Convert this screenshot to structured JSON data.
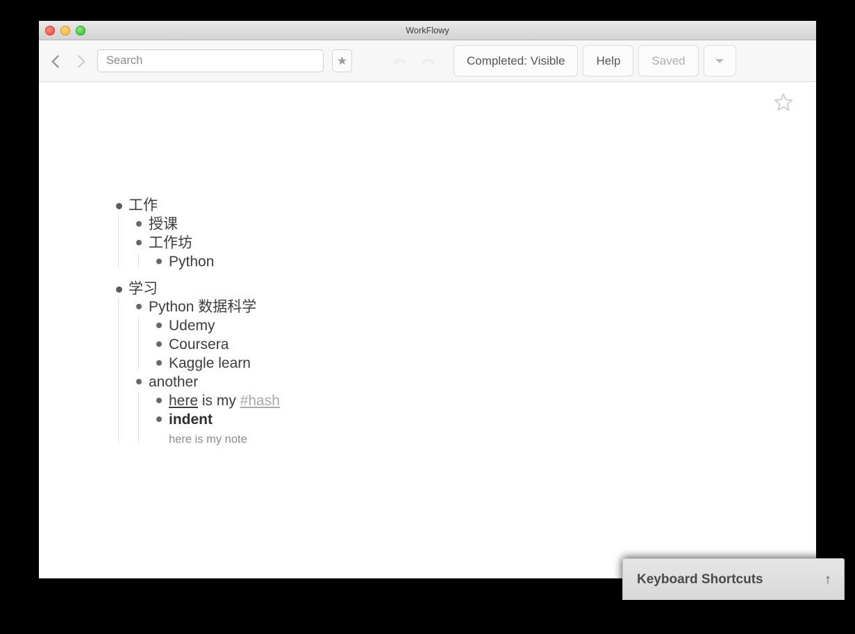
{
  "window": {
    "title": "WorkFlowy",
    "traffic_lights": [
      "close-button",
      "minimize-button",
      "maximize-button"
    ]
  },
  "toolbar": {
    "back_label": "‹",
    "forward_label": "›",
    "search": {
      "value": "",
      "placeholder": "Search"
    },
    "starred_button": "star-icon",
    "undo_label": "undo",
    "redo_label": "redo",
    "completed_label": "Completed: Visible",
    "help_label": "Help",
    "saved_label": "Saved",
    "menu_label": "▾"
  },
  "content": {
    "page_star": "star-outline-icon",
    "outline": [
      {
        "text": "工作",
        "level": 0,
        "children": [
          {
            "text": "授课",
            "level": 1,
            "children": []
          },
          {
            "text": "工作坊",
            "level": 1,
            "children": [
              {
                "text": "Python",
                "level": 2,
                "children": []
              }
            ]
          }
        ]
      },
      {
        "text": "学习",
        "level": 0,
        "children": [
          {
            "text": "Python 数据科学",
            "level": 1,
            "children": [
              {
                "text": "Udemy",
                "level": 2,
                "children": []
              },
              {
                "text": "Coursera",
                "level": 2,
                "children": []
              },
              {
                "text": "Kaggle learn",
                "level": 2,
                "children": []
              }
            ]
          },
          {
            "text": "another",
            "level": 1,
            "children": [
              {
                "text": "here is my #hash",
                "rich": {
                  "link": "here",
                  "middle": " is my ",
                  "tag": "#hash"
                },
                "level": 2,
                "children": []
              },
              {
                "text": "indent",
                "bold": true,
                "note": "here is my note",
                "level": 2,
                "children": []
              }
            ]
          }
        ]
      }
    ]
  },
  "shortcuts_panel": {
    "title": "Keyboard Shortcuts",
    "arrow": "↑"
  },
  "colors": {
    "bullet": "#5c5c5c",
    "text": "#3c3c3c",
    "note": "#8b8b8b",
    "tag": "#a8a8a8",
    "guide_line": "#dcdcdc",
    "titlebar_top": "#ebebeb",
    "toolbar_bg": "#f7f7f7"
  }
}
